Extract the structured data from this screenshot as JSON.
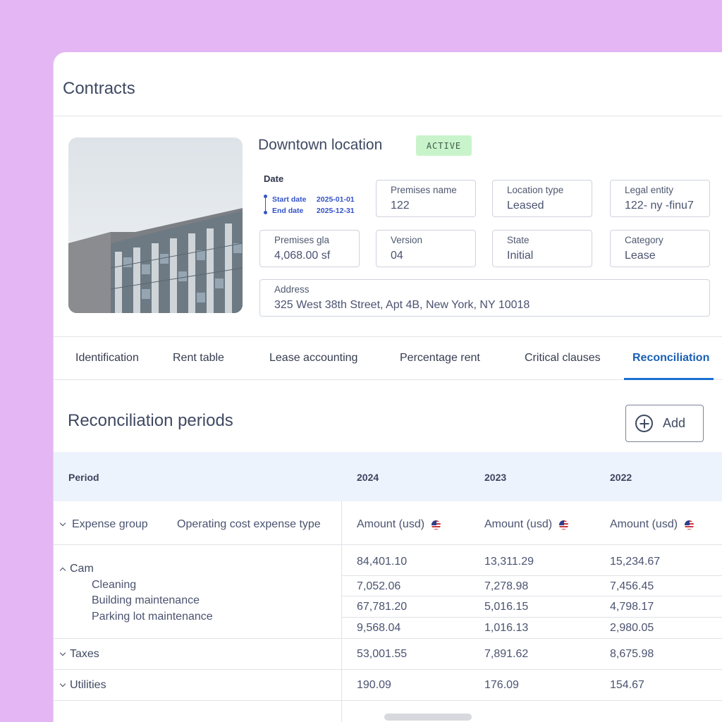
{
  "page": {
    "title": "Contracts"
  },
  "location": {
    "name": "Downtown location",
    "status": "ACTIVE",
    "date": {
      "heading": "Date",
      "start_label": "Start date",
      "start_value": "2025-01-01",
      "end_label": "End date",
      "end_value": "2025-12-31"
    },
    "fields": {
      "premises_name": {
        "label": "Premises name",
        "value": "122"
      },
      "location_type": {
        "label": "Location type",
        "value": "Leased"
      },
      "legal_entity": {
        "label": "Legal entity",
        "value": "122- ny -finu7"
      },
      "premises_gla": {
        "label": "Premises gla",
        "value": "4,068.00 sf"
      },
      "version": {
        "label": "Version",
        "value": "04"
      },
      "state": {
        "label": "State",
        "value": "Initial"
      },
      "category": {
        "label": "Category",
        "value": "Lease"
      },
      "address": {
        "label": "Address",
        "value": "325 West 38th Street, Apt 4B, New York, NY 10018"
      }
    }
  },
  "tabs": [
    {
      "label": "Identification"
    },
    {
      "label": "Rent table"
    },
    {
      "label": "Lease accounting"
    },
    {
      "label": "Percentage rent"
    },
    {
      "label": "Critical clauses"
    },
    {
      "label": "Reconciliation",
      "active": true
    }
  ],
  "section": {
    "title": "Reconciliation periods",
    "add_label": "Add"
  },
  "table": {
    "period_label": "Period",
    "years": [
      "2024",
      "2023",
      "2022"
    ],
    "expense_group_label": "Expense group",
    "expense_type_label": "Operating cost expense type",
    "amount_label": "Amount (usd)",
    "groups": {
      "cam": {
        "name": "Cam",
        "totals": [
          "84,401.10",
          "13,311.29",
          "15,234.67"
        ],
        "items": [
          {
            "name": "Cleaning",
            "values": [
              "7,052.06",
              "7,278.98",
              "7,456.45"
            ]
          },
          {
            "name": "Building maintenance",
            "values": [
              "67,781.20",
              "5,016.15",
              "4,798.17"
            ]
          },
          {
            "name": "Parking lot maintenance",
            "values": [
              "9,568.04",
              "1,016.13",
              "2,980.05"
            ]
          }
        ]
      },
      "taxes": {
        "name": "Taxes",
        "values": [
          "53,001.55",
          "7,891.62",
          "8,675.98"
        ]
      },
      "utilities": {
        "name": "Utilities",
        "values": [
          "190.09",
          "176.09",
          "154.67"
        ]
      }
    }
  },
  "colors": {
    "background": "#e4b6f3",
    "accent": "#1a6fd0",
    "badge_bg": "#c9f4cb",
    "table_header_bg": "#edf3fc"
  }
}
